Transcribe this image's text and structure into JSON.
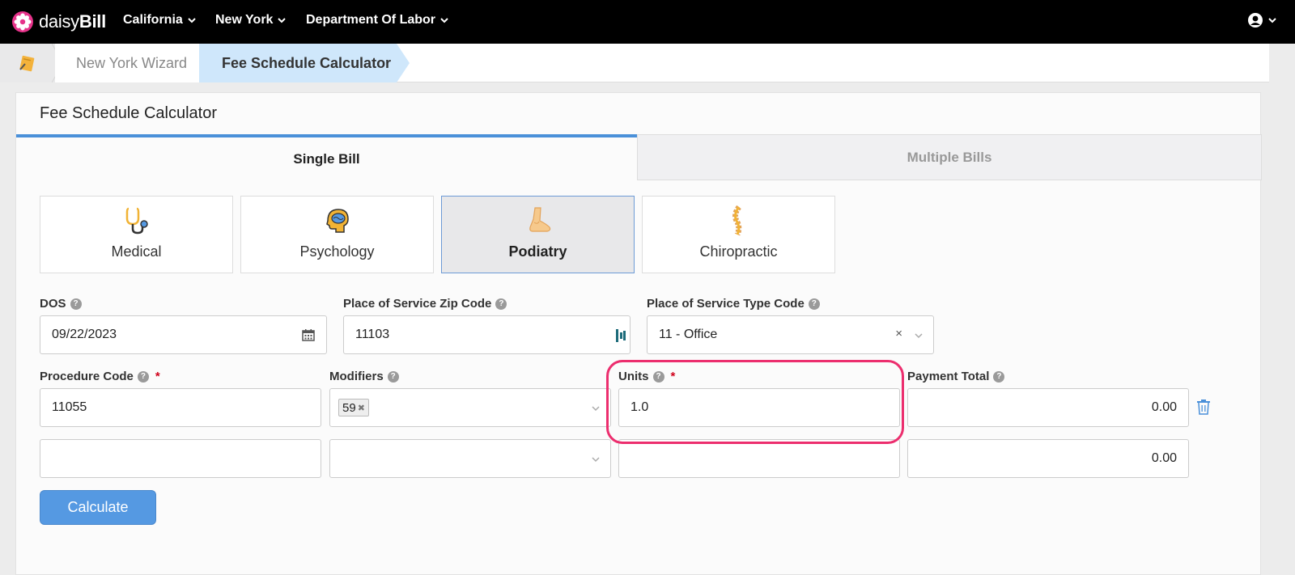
{
  "nav": {
    "logo_prefix": "daisy",
    "logo_suffix": "Bill",
    "items": [
      "California",
      "New York",
      "Department Of Labor"
    ]
  },
  "breadcrumb": {
    "items": [
      "New York Wizard",
      "Fee Schedule Calculator"
    ]
  },
  "card": {
    "title": "Fee Schedule Calculator",
    "tabs": [
      "Single Bill",
      "Multiple Bills"
    ],
    "active_tab": "Single Bill"
  },
  "categories": {
    "items": [
      {
        "label": "Medical",
        "icon": "stethoscope-icon"
      },
      {
        "label": "Psychology",
        "icon": "brain-icon"
      },
      {
        "label": "Podiatry",
        "icon": "foot-icon"
      },
      {
        "label": "Chiropractic",
        "icon": "spine-icon"
      }
    ],
    "selected": "Podiatry"
  },
  "form": {
    "dos_label": "DOS",
    "dos_value": "09/22/2023",
    "zip_label": "Place of Service Zip Code",
    "zip_value": "11103",
    "pos_type_label": "Place of Service Type Code",
    "pos_type_value": "11 - Office",
    "procedure_label": "Procedure Code",
    "modifiers_label": "Modifiers",
    "units_label": "Units",
    "payment_label": "Payment Total",
    "rows": [
      {
        "procedure": "11055",
        "modifier": "59",
        "units": "1.0",
        "payment": "0.00"
      },
      {
        "procedure": "",
        "modifier": "",
        "units": "",
        "payment": "0.00"
      }
    ]
  },
  "actions": {
    "calculate_label": "Calculate"
  },
  "colors": {
    "accent": "#4a90d9",
    "highlight": "#ec2e6e",
    "required": "#d0021b"
  }
}
